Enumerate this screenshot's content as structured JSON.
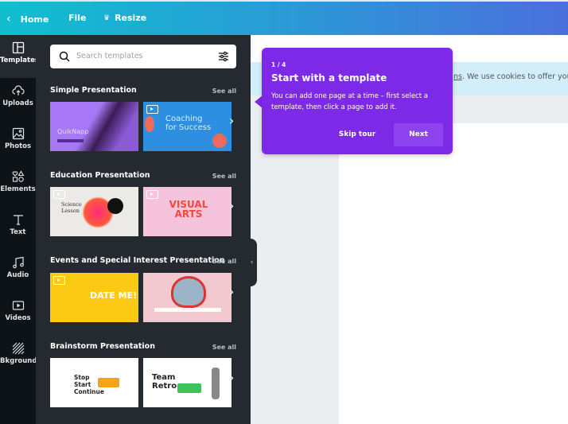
{
  "topbar": {
    "home": "Home",
    "file": "File",
    "resize": "Resize",
    "gradient": [
      "#10bfcf",
      "#4a6fdc"
    ]
  },
  "rail": [
    {
      "label": "Templates",
      "icon": "templates-icon"
    },
    {
      "label": "Uploads",
      "icon": "cloud-upload-icon"
    },
    {
      "label": "Photos",
      "icon": "image-icon"
    },
    {
      "label": "Elements",
      "icon": "shapes-icon"
    },
    {
      "label": "Text",
      "icon": "text-icon"
    },
    {
      "label": "Audio",
      "icon": "music-icon"
    },
    {
      "label": "Videos",
      "icon": "video-icon"
    },
    {
      "label": "Bkground",
      "icon": "background-icon"
    }
  ],
  "search": {
    "placeholder": "Search templates"
  },
  "sections": [
    {
      "title": "Simple Presentation",
      "see_all": "See all",
      "thumbs": [
        {
          "text": "QuikNapp"
        },
        {
          "text": "Coaching for Success"
        }
      ]
    },
    {
      "title": "Education Presentation",
      "see_all": "See all",
      "thumbs": [
        {
          "text": "Science Lesson"
        },
        {
          "text": "VISUAL ARTS"
        }
      ]
    },
    {
      "title": "Events and Special Interest Presentation",
      "see_all": "See all",
      "thumbs": [
        {
          "text": "DATE ME!"
        },
        {
          "text": ""
        }
      ]
    },
    {
      "title": "Brainstorm Presentation",
      "see_all": "See all",
      "thumbs": [
        {
          "text": "Stop Start Continue"
        },
        {
          "text": "Team Retro"
        }
      ]
    }
  ],
  "cookie": {
    "link_tail": "ns",
    "text": ". We use cookies to offer you o"
  },
  "tour": {
    "step": "1 / 4",
    "title": "Start with a template",
    "body": "You can add one page at a time – first select a template, then click a page to add it.",
    "skip": "Skip tour",
    "next": "Next",
    "color": "#7d2ae8"
  }
}
